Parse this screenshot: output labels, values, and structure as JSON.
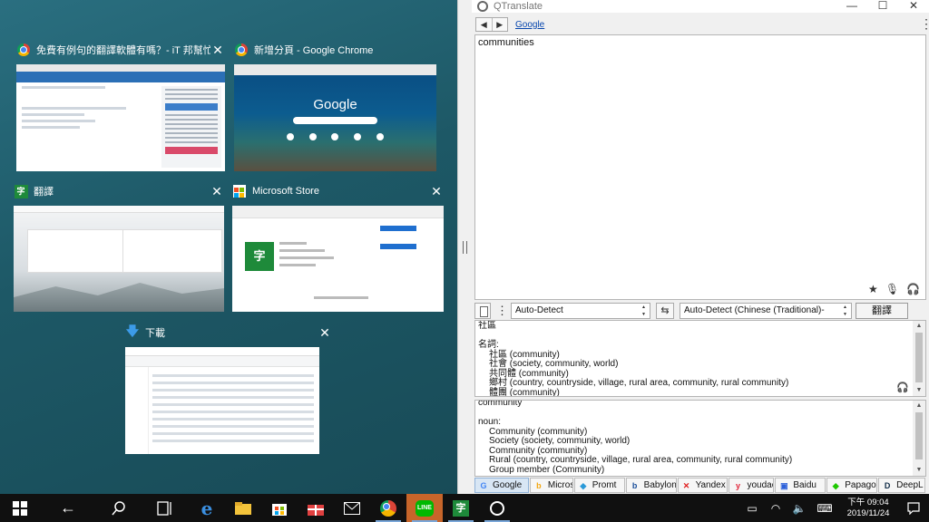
{
  "taskview": {
    "windows": [
      {
        "title": "免費有例句的翻譯軟體有嗎？- iT 邦幫忙::一..."
      },
      {
        "title": "新增分頁 - Google Chrome",
        "logo": "Google"
      },
      {
        "title": "翻譯"
      },
      {
        "title": "Microsoft Store"
      },
      {
        "title": "下載"
      }
    ]
  },
  "qtranslate": {
    "title": "QTranslate",
    "nav_link": "Google",
    "source_text": "communities",
    "source_lang": "Auto-Detect",
    "direction": "Auto-Detect (Chinese (Traditional)-English)",
    "translate_label": "翻譯",
    "result_lines": [
      {
        "text": "社區",
        "indent": false
      },
      {
        "text": "",
        "indent": false
      },
      {
        "text": "名詞:",
        "indent": false
      },
      {
        "text": "社區 (community)",
        "indent": true
      },
      {
        "text": "社會 (society, community, world)",
        "indent": true
      },
      {
        "text": "共同體 (community)",
        "indent": true
      },
      {
        "text": "鄉村 (country, countryside, village, rural area, community, rural community)",
        "indent": true
      },
      {
        "text": "體團 (community)",
        "indent": true
      }
    ],
    "back_lines": [
      {
        "text": "community",
        "indent": false
      },
      {
        "text": "",
        "indent": false
      },
      {
        "text": "noun:",
        "indent": false
      },
      {
        "text": "Community (community)",
        "indent": true
      },
      {
        "text": "Society (society, community, world)",
        "indent": true
      },
      {
        "text": "Community (community)",
        "indent": true
      },
      {
        "text": "Rural (country, countryside, village, rural area, community, rural community)",
        "indent": true
      },
      {
        "text": "Group member (Community)",
        "indent": true
      }
    ],
    "services": [
      {
        "label": "Google",
        "icon": "google-icon",
        "glyph": "G",
        "color": "#4285f4",
        "active": true
      },
      {
        "label": "Micros...",
        "icon": "bing-icon",
        "glyph": "b",
        "color": "#f3a712",
        "active": false
      },
      {
        "label": "Promt",
        "icon": "promt-icon",
        "glyph": "◆",
        "color": "#2c9ad8",
        "active": false
      },
      {
        "label": "Babylon",
        "icon": "babylon-icon",
        "glyph": "b",
        "color": "#1b4f9b",
        "active": false
      },
      {
        "label": "Yandex",
        "icon": "yandex-icon",
        "glyph": "✕",
        "color": "#e02020",
        "active": false
      },
      {
        "label": "youdao",
        "icon": "youdao-icon",
        "glyph": "y",
        "color": "#e1253a",
        "active": false
      },
      {
        "label": "Baidu",
        "icon": "baidu-icon",
        "glyph": "▣",
        "color": "#2b5fd9",
        "active": false
      },
      {
        "label": "Papago",
        "icon": "papago-icon",
        "glyph": "◆",
        "color": "#1ec800",
        "active": false
      },
      {
        "label": "DeepL",
        "icon": "deepl-icon",
        "glyph": "D",
        "color": "#0f2b46",
        "active": false
      }
    ]
  },
  "taskbar": {
    "time": "下午 09:04",
    "date": "2019/11/24"
  },
  "colors": {
    "accent_taskbar": "#c7652a",
    "translator_green": "#1e8a3a",
    "link_blue": "#0645ad"
  }
}
